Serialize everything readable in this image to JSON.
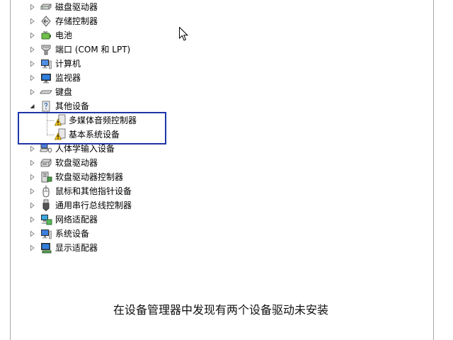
{
  "device_tree": {
    "items": [
      {
        "label": "磁盘驱动器",
        "icon": "disk-drive-icon",
        "expanded": false
      },
      {
        "label": "存储控制器",
        "icon": "storage-controller-icon",
        "expanded": false
      },
      {
        "label": "电池",
        "icon": "battery-icon",
        "expanded": false
      },
      {
        "label": "端口 (COM 和 LPT)",
        "icon": "port-icon",
        "expanded": false
      },
      {
        "label": "计算机",
        "icon": "computer-icon",
        "expanded": false
      },
      {
        "label": "监视器",
        "icon": "monitor-icon",
        "expanded": false
      },
      {
        "label": "键盘",
        "icon": "keyboard-icon",
        "expanded": false
      },
      {
        "label": "其他设备",
        "icon": "other-devices-icon",
        "expanded": true,
        "children": [
          {
            "label": "多媒体音频控制器",
            "icon": "warning-device-icon"
          },
          {
            "label": "基本系统设备",
            "icon": "warning-device-icon"
          }
        ]
      },
      {
        "label": "人体学输入设备",
        "icon": "hid-icon",
        "expanded": false
      },
      {
        "label": "软盘驱动器",
        "icon": "floppy-drive-icon",
        "expanded": false
      },
      {
        "label": "软盘驱动器控制器",
        "icon": "floppy-controller-icon",
        "expanded": false
      },
      {
        "label": "鼠标和其他指针设备",
        "icon": "mouse-icon",
        "expanded": false
      },
      {
        "label": "通用串行总线控制器",
        "icon": "usb-icon",
        "expanded": false
      },
      {
        "label": "网络适配器",
        "icon": "network-adapter-icon",
        "expanded": false
      },
      {
        "label": "系统设备",
        "icon": "system-devices-icon",
        "expanded": false
      },
      {
        "label": "显示适配器",
        "icon": "display-adapter-icon",
        "expanded": false
      }
    ]
  },
  "caption": "在设备管理器中发现有两个设备驱动未安装",
  "colors": {
    "highlight_border": "#2035a8",
    "warning_yellow": "#f5c518",
    "background": "#ffffff"
  }
}
